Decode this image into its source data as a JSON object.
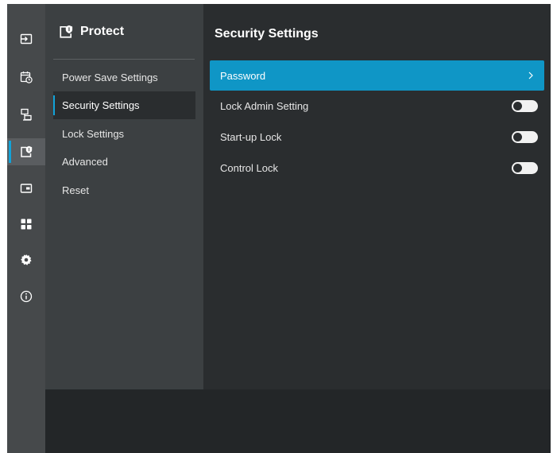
{
  "rail": {
    "items": [
      {
        "icon": "input-icon"
      },
      {
        "icon": "schedule-icon"
      },
      {
        "icon": "multi-display-icon"
      },
      {
        "icon": "protect-icon",
        "active": true
      },
      {
        "icon": "pip-icon"
      },
      {
        "icon": "apps-grid-icon"
      },
      {
        "icon": "gear-icon"
      },
      {
        "icon": "info-icon"
      }
    ]
  },
  "submenu": {
    "title": "Protect",
    "icon": "protect-icon",
    "items": [
      {
        "label": "Power Save Settings"
      },
      {
        "label": "Security Settings",
        "active": true
      },
      {
        "label": "Lock Settings"
      },
      {
        "label": "Advanced"
      },
      {
        "label": "Reset"
      }
    ]
  },
  "main": {
    "title": "Security Settings",
    "rows": [
      {
        "label": "Password",
        "type": "link",
        "selected": true
      },
      {
        "label": "Lock Admin Setting",
        "type": "toggle",
        "state": "off"
      },
      {
        "label": "Start-up Lock",
        "type": "toggle",
        "state": "off"
      },
      {
        "label": "Control Lock",
        "type": "toggle",
        "state": "off"
      }
    ]
  },
  "colors": {
    "accent": "#0f96c6",
    "background": "#2a2d2f",
    "rail": "#46494b",
    "submenu": "#3c4042"
  }
}
